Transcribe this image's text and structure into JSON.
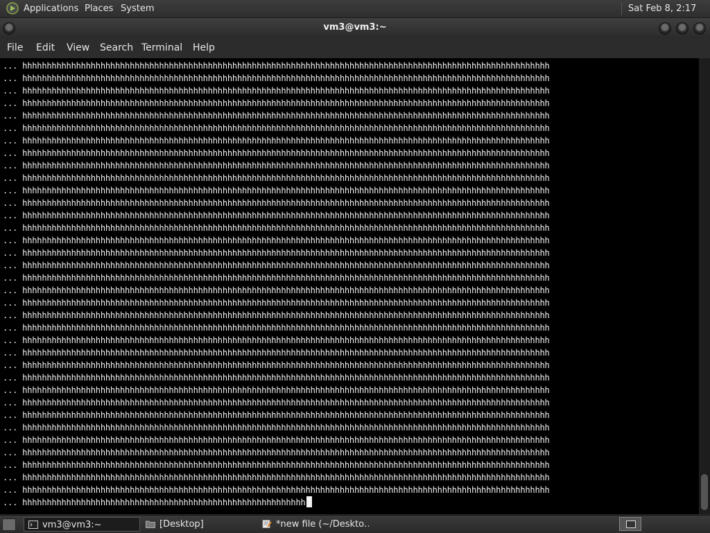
{
  "top_panel": {
    "menus": [
      "Applications",
      "Places",
      "System"
    ],
    "clock": "Sat Feb  8,  2:17 AM"
  },
  "window": {
    "title": "vm3@vm3:~",
    "menu": [
      "File",
      "Edit",
      "View",
      "Search",
      "Terminal",
      "Help"
    ]
  },
  "terminal": {
    "prompt": "...",
    "fill_char": "h",
    "full_line_count": 35,
    "full_line_length": 108,
    "last_line_length": 58
  },
  "taskbar": {
    "tasks": [
      {
        "label": "vm3@vm3:~",
        "icon": "terminal-icon",
        "active": true
      },
      {
        "label": "[Desktop]",
        "icon": "folder-icon",
        "active": false
      },
      {
        "label": "*new file (~/Deskto…",
        "icon": "text-editor-icon",
        "active": false
      }
    ]
  },
  "colors": {
    "terminal_bg": "#000000",
    "terminal_fg": "#f2f2f2",
    "panel_bg": "#2e2e2e"
  }
}
